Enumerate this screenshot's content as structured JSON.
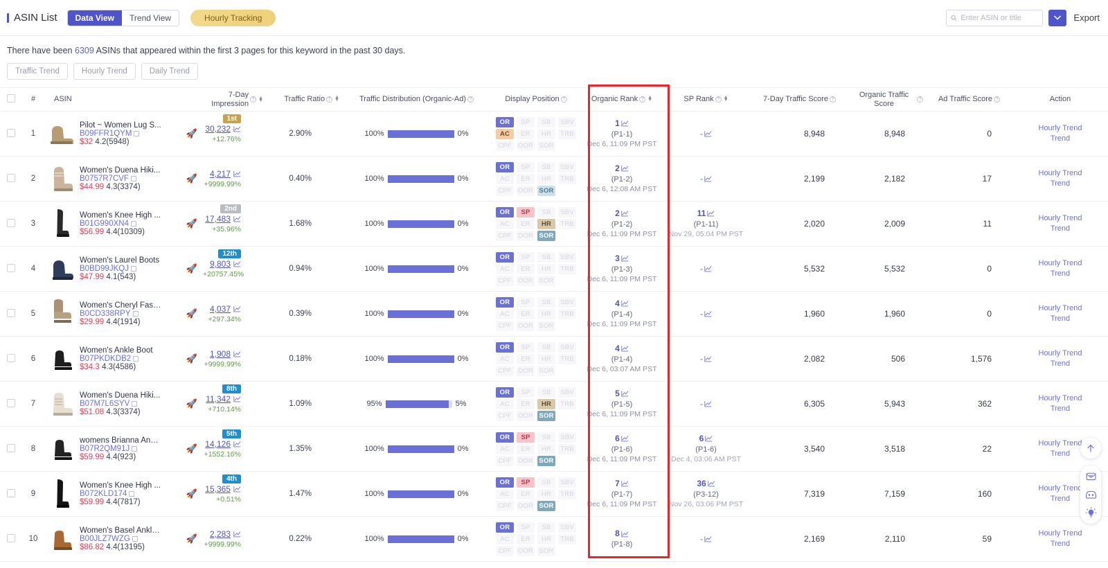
{
  "header": {
    "title": "ASIN List",
    "tabs": [
      {
        "label": "Data View",
        "active": true
      },
      {
        "label": "Trend View",
        "active": false
      }
    ],
    "hourly_tracking_pill": "Hourly Tracking",
    "search_placeholder": "Enter ASIN or title",
    "search_value": "",
    "export_label": "Export"
  },
  "info": {
    "prefix": "There have been ",
    "count": "6309",
    "suffix": " ASINs that appeared within the first 3 pages for this keyword in the past 30 days.",
    "buttons": [
      "Traffic Trend",
      "Hourly Trend",
      "Daily Trend"
    ]
  },
  "columns": [
    {
      "key": "checkbox",
      "label": ""
    },
    {
      "key": "num",
      "label": "#"
    },
    {
      "key": "asin",
      "label": "ASIN"
    },
    {
      "key": "impression",
      "label": "7-Day Impression",
      "info": true,
      "sortable": true
    },
    {
      "key": "traffic_ratio",
      "label": "Traffic Ratio",
      "info": true,
      "sortable": true
    },
    {
      "key": "traffic_distribution",
      "label": "Traffic Distribution (Organic-Ad)",
      "info": true
    },
    {
      "key": "display_position",
      "label": "Display Position",
      "info": true
    },
    {
      "key": "organic_rank",
      "label": "Organic Rank",
      "info": true,
      "sortable": true
    },
    {
      "key": "sp_rank",
      "label": "SP Rank",
      "info": true,
      "sortable": true
    },
    {
      "key": "traffic_score_7d",
      "label": "7-Day Traffic Score",
      "info": true
    },
    {
      "key": "organic_traffic_score",
      "label": "Organic Traffic Score",
      "info": true
    },
    {
      "key": "ad_traffic_score",
      "label": "Ad Traffic Score",
      "info": true
    },
    {
      "key": "action",
      "label": "Action"
    }
  ],
  "position_labels": [
    [
      "OR",
      "SP",
      "SB",
      "SBV"
    ],
    [
      "AC",
      "ER",
      "HR",
      "TRB"
    ],
    [
      "CPF",
      "OOR",
      "SOR",
      ""
    ]
  ],
  "action_links": [
    "Hourly Trend",
    "Trend"
  ],
  "rows": [
    {
      "num": "1",
      "title": "Pilot ~ Women Lug S...",
      "asin": "B09FFR1QYM",
      "price": "$32",
      "rating": "4.2(5948)",
      "rank_badge": "1st",
      "rank_badge_style": "gold",
      "impression": "30,232",
      "delta": "+12.76%",
      "traffic_ratio": "2.90%",
      "organic_pct": "100%",
      "ad_pct": "0%",
      "organic_bar": 100,
      "chips": {
        "OR": "or",
        "AC": "ac"
      },
      "organic_rank": "1",
      "organic_page": "(P1-1)",
      "organic_date": "Dec 6, 11:09 PM PST",
      "sp_rank": "-",
      "sp_page": "",
      "sp_date": "",
      "traffic_score_7d": "8,948",
      "organic_traffic_score": "8,948",
      "ad_traffic_score": "0"
    },
    {
      "num": "2",
      "title": "Women's Duena Hiki...",
      "asin": "B0757R7CVF",
      "price": "$44.99",
      "rating": "4.3(3374)",
      "rank_badge": "",
      "rank_badge_style": "",
      "impression": "4,217",
      "delta": "+9999.99%",
      "traffic_ratio": "0.40%",
      "organic_pct": "100%",
      "ad_pct": "0%",
      "organic_bar": 100,
      "chips": {
        "OR": "or",
        "SOR": "sor-light"
      },
      "organic_rank": "2",
      "organic_page": "(P1-2)",
      "organic_date": "Dec 6, 12:08 AM PST",
      "sp_rank": "-",
      "sp_page": "",
      "sp_date": "",
      "traffic_score_7d": "2,199",
      "organic_traffic_score": "2,182",
      "ad_traffic_score": "17"
    },
    {
      "num": "3",
      "title": "Women's Knee High ...",
      "asin": "B01G990XN4",
      "price": "$56.99",
      "rating": "4.4(10309)",
      "rank_badge": "2nd",
      "rank_badge_style": "silver",
      "impression": "17,483",
      "delta": "+35.96%",
      "traffic_ratio": "1.68%",
      "organic_pct": "100%",
      "ad_pct": "0%",
      "organic_bar": 100,
      "chips": {
        "OR": "or",
        "SP": "sp",
        "HR": "hr",
        "SOR": "sor-dark"
      },
      "organic_rank": "2",
      "organic_page": "(P1-2)",
      "organic_date": "Dec 6, 11:09 PM PST",
      "sp_rank": "11",
      "sp_page": "(P1-11)",
      "sp_date": "Nov 29, 05:04 PM PST",
      "traffic_score_7d": "2,020",
      "organic_traffic_score": "2,009",
      "ad_traffic_score": "11"
    },
    {
      "num": "4",
      "title": "Women's Laurel Boots",
      "asin": "B0BD99JKQJ",
      "price": "$47.99",
      "rating": "4.1(543)",
      "rank_badge": "12th",
      "rank_badge_style": "blue",
      "impression": "9,803",
      "delta": "+20757.45%",
      "traffic_ratio": "0.94%",
      "organic_pct": "100%",
      "ad_pct": "0%",
      "organic_bar": 100,
      "chips": {
        "OR": "or"
      },
      "organic_rank": "3",
      "organic_page": "(P1-3)",
      "organic_date": "Dec 6, 11:09 PM PST",
      "sp_rank": "-",
      "sp_page": "",
      "sp_date": "",
      "traffic_score_7d": "5,532",
      "organic_traffic_score": "5,532",
      "ad_traffic_score": "0"
    },
    {
      "num": "5",
      "title": "Women's Cheryl Fash...",
      "asin": "B0CD338RPY",
      "price": "$29.99",
      "rating": "4.4(1914)",
      "rank_badge": "",
      "rank_badge_style": "",
      "impression": "4,037",
      "delta": "+297.34%",
      "traffic_ratio": "0.39%",
      "organic_pct": "100%",
      "ad_pct": "0%",
      "organic_bar": 100,
      "chips": {
        "OR": "or"
      },
      "organic_rank": "4",
      "organic_page": "(P1-4)",
      "organic_date": "Dec 6, 11:09 PM PST",
      "sp_rank": "-",
      "sp_page": "",
      "sp_date": "",
      "traffic_score_7d": "1,960",
      "organic_traffic_score": "1,960",
      "ad_traffic_score": "0"
    },
    {
      "num": "6",
      "title": "Women's Ankle Boot",
      "asin": "B07PKDKDB2",
      "price": "$34.3",
      "rating": "4.3(4586)",
      "rank_badge": "",
      "rank_badge_style": "",
      "impression": "1,908",
      "delta": "+9999.99%",
      "traffic_ratio": "0.18%",
      "organic_pct": "100%",
      "ad_pct": "0%",
      "organic_bar": 100,
      "chips": {
        "OR": "or"
      },
      "organic_rank": "4",
      "organic_page": "(P1-4)",
      "organic_date": "Dec 6, 03:07 AM PST",
      "sp_rank": "-",
      "sp_page": "",
      "sp_date": "",
      "traffic_score_7d": "2,082",
      "organic_traffic_score": "506",
      "ad_traffic_score": "1,576"
    },
    {
      "num": "7",
      "title": "Women's Duena Hiki...",
      "asin": "B07M7L6SYV",
      "price": "$51.08",
      "rating": "4.3(3374)",
      "rank_badge": "8th",
      "rank_badge_style": "blue",
      "impression": "11,342",
      "delta": "+710.14%",
      "traffic_ratio": "1.09%",
      "organic_pct": "95%",
      "ad_pct": "5%",
      "organic_bar": 95,
      "chips": {
        "OR": "or",
        "HR": "hr",
        "SOR": "sor-dark"
      },
      "organic_rank": "5",
      "organic_page": "(P1-5)",
      "organic_date": "Dec 6, 11:09 PM PST",
      "sp_rank": "-",
      "sp_page": "",
      "sp_date": "",
      "traffic_score_7d": "6,305",
      "organic_traffic_score": "5,943",
      "ad_traffic_score": "362"
    },
    {
      "num": "8",
      "title": "womens Brianna Ankl...",
      "asin": "B07R2QM91J",
      "price": "$59.99",
      "rating": "4.4(923)",
      "rank_badge": "5th",
      "rank_badge_style": "blue",
      "impression": "14,126",
      "delta": "+1552.16%",
      "traffic_ratio": "1.35%",
      "organic_pct": "100%",
      "ad_pct": "0%",
      "organic_bar": 100,
      "chips": {
        "OR": "or",
        "SP": "sp",
        "SOR": "sor-dark"
      },
      "organic_rank": "6",
      "organic_page": "(P1-6)",
      "organic_date": "Dec 6, 11:09 PM PST",
      "sp_rank": "6",
      "sp_page": "(P1-6)",
      "sp_date": "Dec 4, 03:06 AM PST",
      "traffic_score_7d": "3,540",
      "organic_traffic_score": "3,518",
      "ad_traffic_score": "22"
    },
    {
      "num": "9",
      "title": "Women's Knee High ...",
      "asin": "B072KLD174",
      "price": "$59.99",
      "rating": "4.4(7817)",
      "rank_badge": "4th",
      "rank_badge_style": "blue",
      "impression": "15,365",
      "delta": "+0.51%",
      "traffic_ratio": "1.47%",
      "organic_pct": "100%",
      "ad_pct": "0%",
      "organic_bar": 100,
      "chips": {
        "OR": "or",
        "SP": "sp",
        "SOR": "sor-dark"
      },
      "organic_rank": "7",
      "organic_page": "(P1-7)",
      "organic_date": "Dec 6, 11:09 PM PST",
      "sp_rank": "36",
      "sp_page": "(P3-12)",
      "sp_date": "Nov 26, 03:06 PM PST",
      "traffic_score_7d": "7,319",
      "organic_traffic_score": "7,159",
      "ad_traffic_score": "160"
    },
    {
      "num": "10",
      "title": "Women's Basel Ankle...",
      "asin": "B00JLZ7WZG",
      "price": "$86.82",
      "rating": "4.4(13195)",
      "rank_badge": "",
      "rank_badge_style": "",
      "impression": "2,283",
      "delta": "+9999.99%",
      "traffic_ratio": "0.22%",
      "organic_pct": "100%",
      "ad_pct": "0%",
      "organic_bar": 100,
      "chips": {
        "OR": "or"
      },
      "organic_rank": "8",
      "organic_page": "(P1-8)",
      "organic_date": "",
      "sp_rank": "-",
      "sp_page": "",
      "sp_date": "",
      "traffic_score_7d": "2,169",
      "organic_traffic_score": "2,110",
      "ad_traffic_score": "59"
    }
  ],
  "fabs": [
    {
      "name": "scroll-top-icon"
    },
    {
      "name": "feedback-envelope-icon"
    },
    {
      "name": "discord-icon"
    },
    {
      "name": "lightbulb-idea-icon"
    }
  ],
  "colors": {
    "accent": "#4f55c9",
    "link": "#6b70e0",
    "price": "#e0435b",
    "delta": "#5a9e3f",
    "highlight_box": "#f1232a",
    "pill": "#efd07a"
  }
}
